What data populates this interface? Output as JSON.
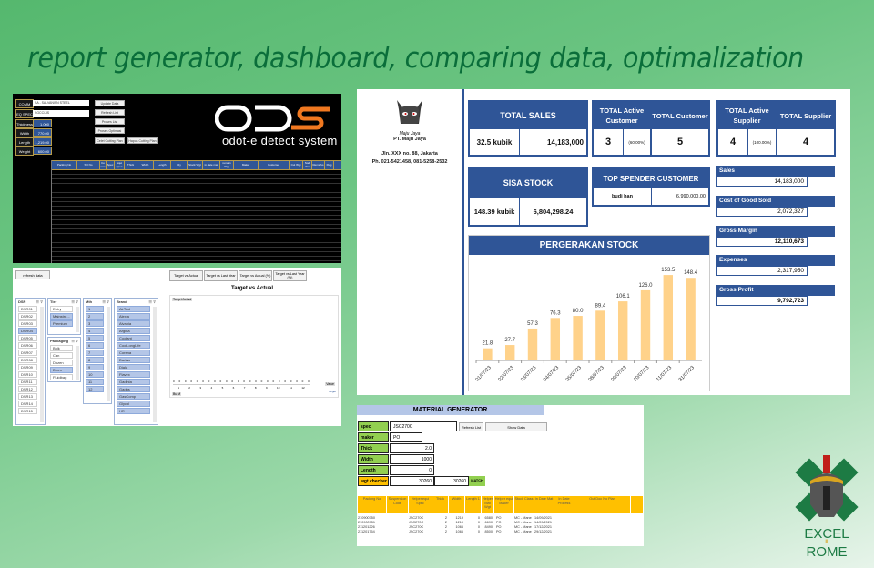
{
  "headline": "report generator, dashboard, comparing data, optimalization",
  "ods_panel": {
    "fields": [
      {
        "label": "COMM",
        "value": "SA - SALVANISN STEEL"
      },
      {
        "label": "EQ SPEC",
        "value": "SGCC/JIS"
      },
      {
        "label": "Thickness",
        "value": "1.000"
      },
      {
        "label": "Width",
        "value": "770.00"
      },
      {
        "label": "Length",
        "value": "1,219.00"
      },
      {
        "label": "Weight",
        "value": "600.00"
      }
    ],
    "buttons": [
      "Update Data Mentah",
      "Refresh List",
      "Proses List",
      "Proses Optimasi",
      "Celet Cutting Plan",
      "Hapus Cutting Plan"
    ],
    "logo_text": "odot-e detect system",
    "grid_headers": [
      "Packing No",
      "SO No",
      "Co mm",
      "Spec",
      "Equi Spec",
      "Thick",
      "Width",
      "Length",
      "Qty",
      "Stock Wgt",
      "in date mat",
      "remain Wgt",
      "Maker",
      "Customer",
      "Cut Wgt",
      "Sod Siz",
      "Remarks",
      "Flag"
    ]
  },
  "pivot_panel": {
    "refresh_label": "refresh data",
    "tab_buttons": [
      "Target vs Actual",
      "Target vs Last Year",
      "Target vs Actual (%)",
      "Target vs Last Year (%)"
    ],
    "chart_title": "Target vs Actual",
    "chart_tag": "Target Actual",
    "chart_xlabels": [
      "1",
      "2",
      "3",
      "4",
      "5",
      "6",
      "7",
      "8",
      "9",
      "10",
      "11",
      "12"
    ],
    "chart_filter_label": "Bu M",
    "chart_value_label": "Value",
    "chart_legend": "Target",
    "slicers": {
      "dsr": {
        "title": "DSR",
        "items": [
          "DSR01",
          "DSR02",
          "DSR03",
          "DSR04",
          "DSR05",
          "DSR06",
          "DSR07",
          "DSR08",
          "DSR09",
          "DSR10",
          "DSR11",
          "DSR12",
          "DSR13",
          "DSR14",
          "DSR15"
        ],
        "selected": [
          "DSR04"
        ]
      },
      "tier": {
        "title": "Tier",
        "items": [
          "Entry",
          "Mainstre...",
          "Premium"
        ],
        "selected": [
          "Mainstre...",
          "Premium"
        ]
      },
      "packaging": {
        "title": "Packaging",
        "items": [
          "Bulk",
          "Can",
          "Dozen",
          "Drum",
          "Fluidbag"
        ],
        "selected": [
          "Drum"
        ]
      },
      "mth": {
        "title": "Mth",
        "items": [
          "1",
          "2",
          "3",
          "4",
          "5",
          "6",
          "7",
          "8",
          "9",
          "10",
          "11",
          "12"
        ],
        "selected": [
          "1",
          "2",
          "3",
          "4",
          "5",
          "6",
          "7",
          "8",
          "9",
          "10",
          "11",
          "12"
        ]
      },
      "brand": {
        "title": "Brand",
        "items": [
          "AirTool",
          "Alexia",
          "Alvania",
          "Argina",
          "Coolant",
          "CoolLongLife",
          "Corena",
          "Darina",
          "Diala",
          "Flavex",
          "Gadinia",
          "Gadus",
          "GasComp",
          "Glycol",
          "HR"
        ],
        "selected": [
          "AirTool",
          "Alexia",
          "Alvania",
          "Argina",
          "Coolant",
          "CoolLongLife",
          "Corena",
          "Darina",
          "Diala",
          "Flavex",
          "Gadinia",
          "Gadus",
          "GasComp",
          "Glycol",
          "HR"
        ]
      }
    }
  },
  "dashboard": {
    "company": {
      "brand": "Maju Jaya",
      "name": "PT. Maju Jaya",
      "address": "Jln. XXX no. 88, Jakarta",
      "phone": "Ph. 021-5421458, 081-5258-2532"
    },
    "total_sales": {
      "title": "TOTAL SALES",
      "volume": "32.5 kubik",
      "amount": "14,183,000"
    },
    "active_customer": {
      "title": "TOTAL Active Customer",
      "count": "3",
      "pct": "(60.00%)"
    },
    "total_customer": {
      "title": "TOTAL Customer",
      "count": "5"
    },
    "active_supplier": {
      "title": "TOTAL Active Supplier",
      "count": "4",
      "pct": "(100.00%)"
    },
    "total_supplier": {
      "title": "TOTAL Supplier",
      "count": "4"
    },
    "sisa_stock": {
      "title": "SISA STOCK",
      "volume": "148.39 kubik",
      "amount": "6,804,298.24"
    },
    "top_spender": {
      "title": "TOP SPENDER CUSTOMER",
      "name": "budi han",
      "amount": "6,990,000.00"
    },
    "financials": [
      {
        "label": "Sales",
        "value": "14,183,000",
        "bold": false
      },
      {
        "label": "Cost of Good Sold",
        "value": "2,072,327",
        "bold": false
      },
      {
        "label": "Gross Margin",
        "value": "12,110,673",
        "bold": true
      },
      {
        "label": "Expenses",
        "value": "2,317,950",
        "bold": false
      },
      {
        "label": "Gross Profit",
        "value": "9,792,723",
        "bold": true
      }
    ],
    "colors": {
      "primary": "#2f5597",
      "bar": "#ffd28a"
    }
  },
  "chart_data": {
    "type": "bar",
    "title": "PERGERAKAN STOCK",
    "categories": [
      "01/07/23",
      "02/07/23",
      "03/07/23",
      "04/07/23",
      "05/07/23",
      "08/07/23",
      "09/07/23",
      "10/07/23",
      "11/07/23",
      "31/07/23"
    ],
    "values": [
      21.8,
      27.7,
      57.3,
      76.3,
      80.0,
      89.4,
      106.1,
      126.0,
      153.5,
      148.4
    ],
    "data_labels": [
      "21.8",
      "27.7",
      "57.3",
      "76.3",
      "80.0",
      "89.4",
      "106.1",
      "126.0",
      "153.5",
      "148.4"
    ],
    "xlabel": "",
    "ylabel": "",
    "ylim": [
      0,
      170
    ],
    "grid": false,
    "legend": "none"
  },
  "material_generator": {
    "title": "MATERIAL GENERATOR",
    "fields": [
      {
        "label": "spec",
        "value": "JSC270C"
      },
      {
        "label": "maker",
        "value": "PO"
      },
      {
        "label": "Thick",
        "value": "2.0"
      },
      {
        "label": "Width",
        "value": "1000"
      },
      {
        "label": "Length",
        "value": "0"
      }
    ],
    "wgt_checker": {
      "label": "wgt checker",
      "value1": "30260",
      "value2": "30260",
      "status": "MATCH"
    },
    "buttons": {
      "refresh": "Refresh List",
      "show": "Show Data"
    },
    "table_headers": [
      "Packing No",
      "Suspension Code",
      "Helper equi Spec",
      "Thick",
      "Width",
      "Length 1",
      "Helper Mat Wgt",
      "Helper equi Maker",
      "Stock Class",
      "In Date Mat",
      "In Date Process",
      "Out Doc No Plan"
    ],
    "rows": [
      [
        "210900750",
        "",
        "JSC270C",
        "2",
        "1219",
        "0",
        "6580",
        "PO",
        "MC - Mane",
        "14/09/2021",
        "",
        ""
      ],
      [
        "210900751",
        "",
        "JSC270C",
        "2",
        "1219",
        "0",
        "6690",
        "PO",
        "MC - Mane",
        "14/09/2021",
        "",
        ""
      ],
      [
        "211201226",
        "",
        "JSC270C",
        "2",
        "1066",
        "0",
        "8490",
        "PO",
        "MC - Mane",
        "17/12/2021",
        "",
        ""
      ],
      [
        "211201754",
        "",
        "JSC270C",
        "2",
        "1066",
        "0",
        "8500",
        "PO",
        "MC - Mane",
        "29/12/2021",
        "",
        ""
      ]
    ]
  },
  "watermark": {
    "line1": "EXCEL",
    "mid": "II",
    "line2": "ROME"
  }
}
